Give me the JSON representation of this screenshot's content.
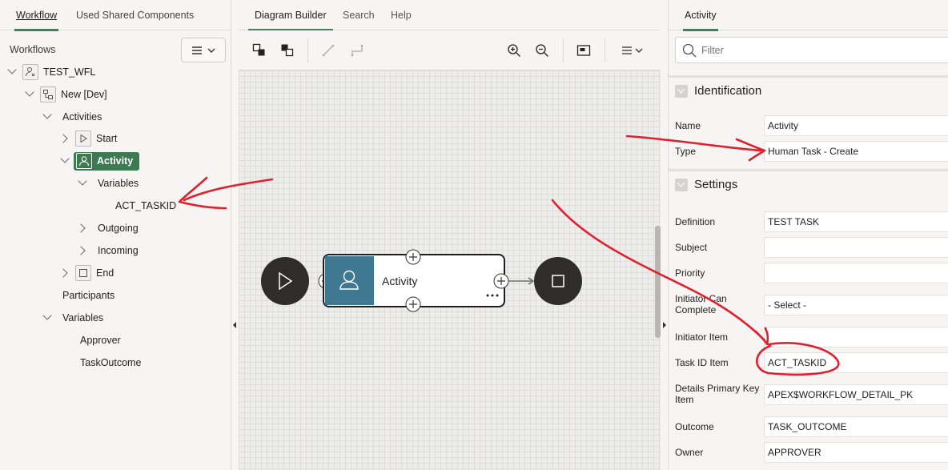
{
  "left": {
    "tabs": [
      "Workflow",
      "Used Shared Components"
    ],
    "workflows_label": "Workflows",
    "tree": {
      "root": "TEST_WFL",
      "version": "New [Dev]",
      "activities": "Activities",
      "start": "Start",
      "activity": "Activity",
      "variables": "Variables",
      "act_taskid": "ACT_TASKID",
      "outgoing": "Outgoing",
      "incoming": "Incoming",
      "end": "End",
      "participants": "Participants",
      "wf_variables": "Variables",
      "approver": "Approver",
      "taskoutcome": "TaskOutcome"
    }
  },
  "center": {
    "tabs": [
      "Diagram Builder",
      "Search",
      "Help"
    ],
    "diagram": {
      "activity_label": "Activity"
    }
  },
  "right": {
    "tab": "Activity",
    "filter_placeholder": "Filter",
    "identification": {
      "title": "Identification",
      "name_label": "Name",
      "name_value": "Activity",
      "type_label": "Type",
      "type_value": "Human Task - Create"
    },
    "settings": {
      "title": "Settings",
      "fields": [
        {
          "label": "Definition",
          "value": "TEST TASK"
        },
        {
          "label": "Subject",
          "value": ""
        },
        {
          "label": "Priority",
          "value": ""
        },
        {
          "label": "Initiator Can Complete",
          "value": "- Select -"
        },
        {
          "label": "Initiator Item",
          "value": ""
        },
        {
          "label": "Task ID Item",
          "value": "ACT_TASKID"
        },
        {
          "label": "Details Primary Key Item",
          "value": "APEX$WORKFLOW_DETAIL_PK"
        },
        {
          "label": "Outcome",
          "value": "TASK_OUTCOME"
        },
        {
          "label": "Owner",
          "value": "APPROVER"
        }
      ]
    }
  },
  "colors": {
    "accent": "#4f7a5d",
    "activity_green": "#3d7a52",
    "activity_icon_bg": "#3f7891",
    "annotation_red": "#e0202e"
  }
}
